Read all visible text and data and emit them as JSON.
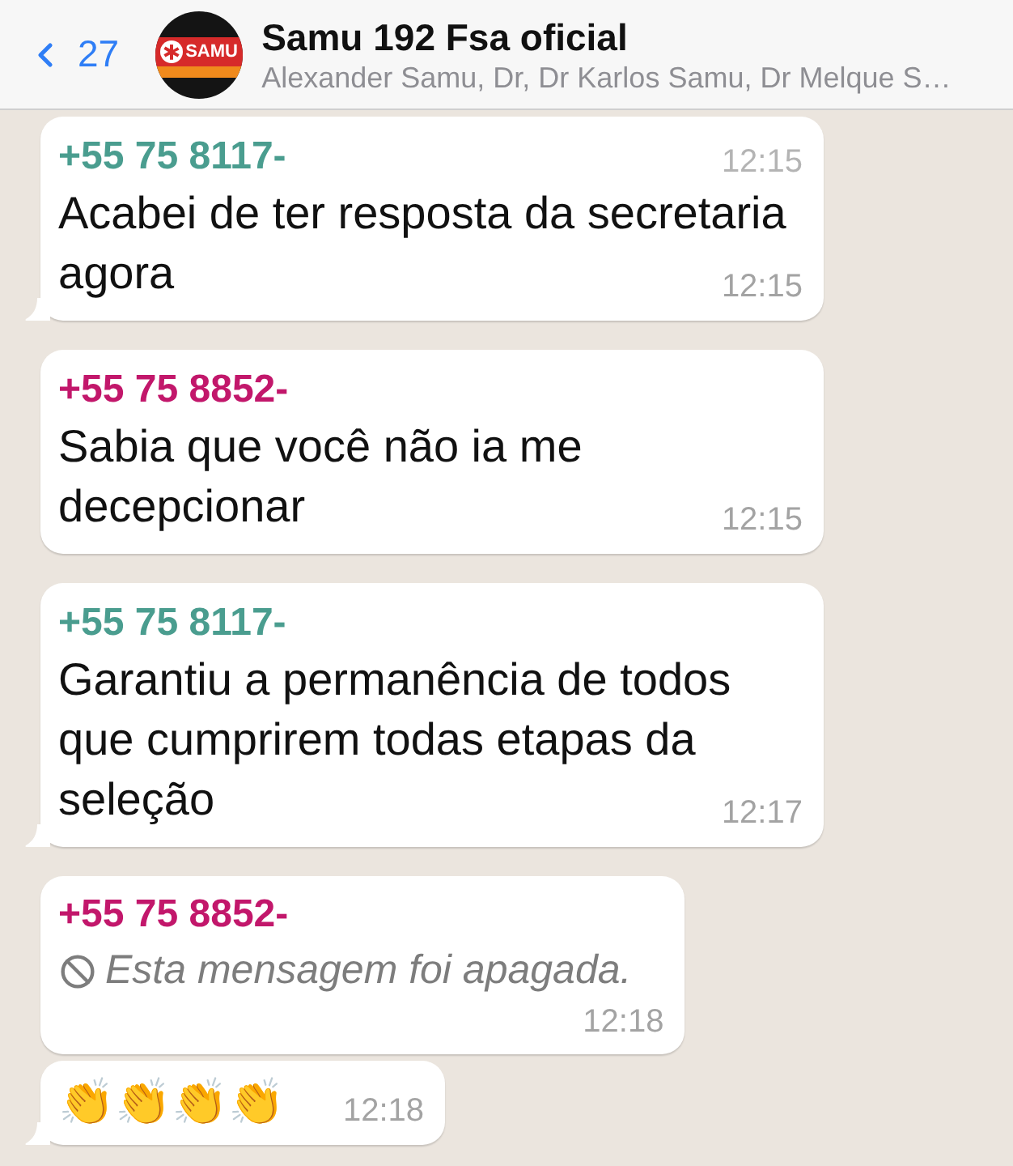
{
  "header": {
    "back": {
      "count": "27"
    },
    "avatar": {
      "logo_text": "SAMU"
    },
    "title": "Samu 192 Fsa oficial",
    "subtitle": "Alexander Samu, Dr, Dr Karlos Samu, Dr Melque S…"
  },
  "messages": [
    {
      "kind": "text",
      "sender": "+55 75 8117-",
      "color": "#4a9d8f",
      "faded_time": "12:15",
      "text": "Acabei de ter resposta da secretaria agora",
      "time": "12:15",
      "tail": true
    },
    {
      "kind": "text",
      "sender": "+55 75 8852-",
      "color": "#c2176b",
      "text": "Sabia que você não ia me decepcionar",
      "time": "12:15",
      "tail": false
    },
    {
      "kind": "text",
      "sender": "+55 75 8117-",
      "color": "#4a9d8f",
      "text": "Garantiu a permanência de todos que cumprirem todas etapas da seleção",
      "time": "12:17",
      "tail": true
    },
    {
      "kind": "deleted",
      "sender": "+55 75 8852-",
      "color": "#c2176b",
      "text": "Esta mensagem foi apagada.",
      "time": "12:18",
      "tail": false
    },
    {
      "kind": "emoji",
      "text": "👏👏👏👏",
      "time": "12:18",
      "tail": true
    }
  ]
}
